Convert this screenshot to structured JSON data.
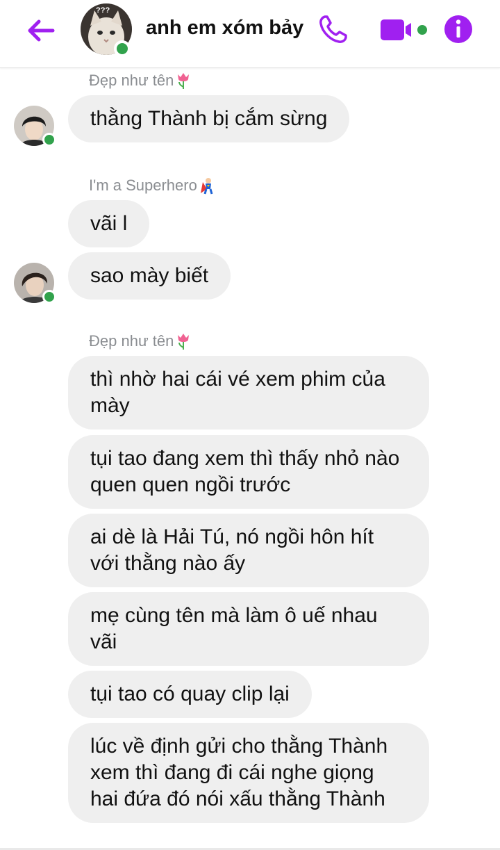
{
  "header": {
    "title": "anh em xóm bảy",
    "accent_color": "#a020f0",
    "online_color": "#31a24c",
    "icons": [
      "back-arrow-icon",
      "phone-icon",
      "video-camera-icon",
      "info-icon"
    ]
  },
  "messages": [
    {
      "sender": "Đẹp như tên",
      "sender_emoji": "tulip",
      "bubbles": [
        "thằng Thành bị cắm sừng"
      ]
    },
    {
      "sender": "I'm a Superhero",
      "sender_emoji": "superhero",
      "bubbles": [
        "vãi l",
        "sao mày biết"
      ]
    },
    {
      "sender": "Đẹp như tên",
      "sender_emoji": "tulip",
      "bubbles": [
        "thì nhờ hai cái vé xem phim của mày",
        "tụi tao đang xem thì thấy nhỏ nào quen quen ngồi trước",
        "ai dè là Hải Tú, nó ngồi hôn hít với thằng nào ấy",
        "mẹ cùng tên mà làm ô uế nhau vãi",
        "tụi tao có quay clip lại",
        "lúc về định gửi cho thằng Thành xem thì đang đi cái nghe giọng hai đứa đó nói xấu thằng Thành"
      ]
    }
  ]
}
